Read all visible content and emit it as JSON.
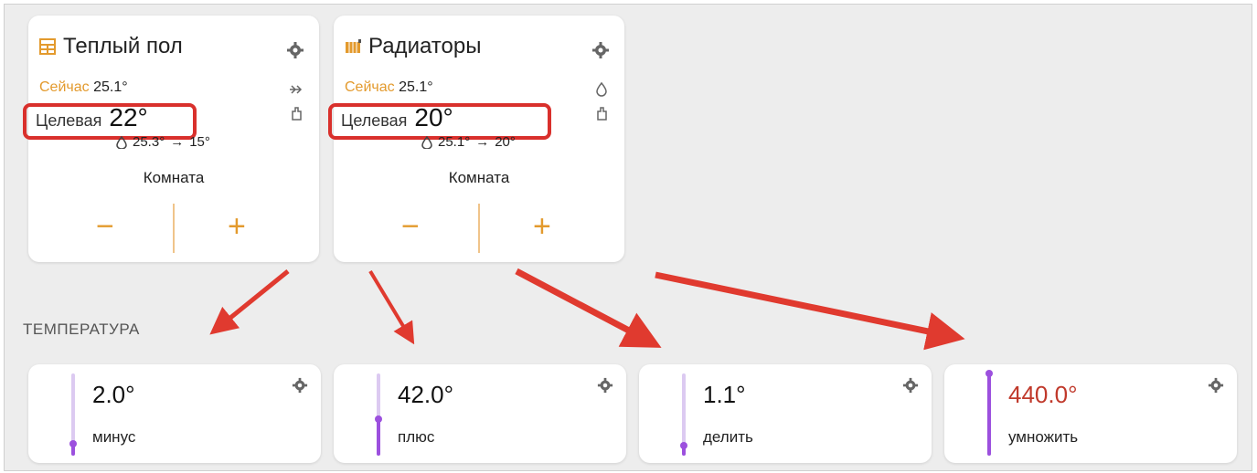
{
  "thermostats": [
    {
      "title": "Теплый пол",
      "icon": "floor-heating-icon",
      "now_label": "Сейчас",
      "now_value": "25.1°",
      "target_label": "Целевая",
      "target_value": "22°",
      "meta_humidity": "25.3°",
      "meta_arrow": "→",
      "meta_setpoint": "15°",
      "room": "Комната",
      "minus_label": "−",
      "plus_label": "+",
      "side_icons": [
        "fan-icon",
        "hand-icon"
      ]
    },
    {
      "title": "Радиаторы",
      "icon": "radiator-icon",
      "now_label": "Сейчас",
      "now_value": "25.1°",
      "target_label": "Целевая",
      "target_value": "20°",
      "meta_humidity": "25.1°",
      "meta_arrow": "→",
      "meta_setpoint": "20°",
      "room": "Комната",
      "minus_label": "−",
      "plus_label": "+",
      "side_icons": [
        "drop-icon",
        "hand-icon"
      ]
    }
  ],
  "section_title": "ТЕМПЕРАТУРА",
  "sensors": [
    {
      "value": "2.0°",
      "name": "минус",
      "level": 0.15,
      "value_color": "#111111"
    },
    {
      "value": "42.0°",
      "name": "плюс",
      "level": 0.45,
      "value_color": "#111111"
    },
    {
      "value": "1.1°",
      "name": "делить",
      "level": 0.12,
      "value_color": "#111111"
    },
    {
      "value": "440.0°",
      "name": "умножить",
      "level": 1.0,
      "value_color": "#c0392b"
    }
  ],
  "colors": {
    "accent": "#e39a2d",
    "highlight": "#d9302c",
    "slider": "#9c50de",
    "slider_track": "#dccaf1",
    "arrow": "#e03a2f"
  }
}
